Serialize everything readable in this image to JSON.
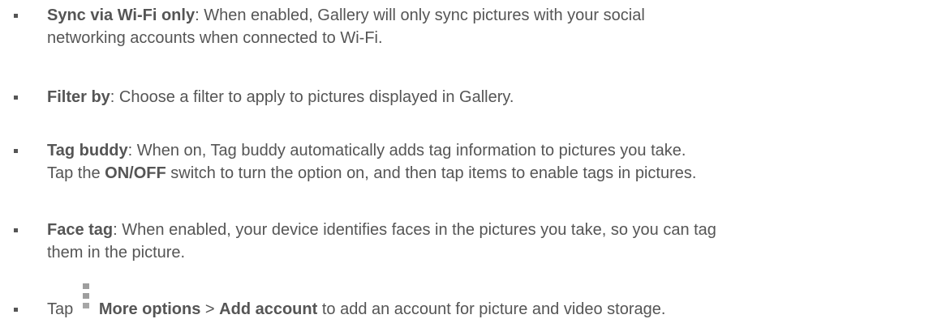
{
  "items": [
    {
      "term": "Sync via Wi-Fi only",
      "line1": ": When enabled, Gallery will only sync pictures with your social",
      "line2": "networking accounts when connected to Wi-Fi."
    },
    {
      "term": "Filter by",
      "line1": ": Choose a filter to apply to pictures displayed in Gallery."
    },
    {
      "term": "Tag buddy",
      "line1": ": When on, Tag buddy automatically adds tag information to pictures you take.",
      "line2_pre": "Tap the ",
      "line2_bold": "ON/OFF",
      "line2_post": " switch to turn the option on, and then tap items to enable tags in pictures."
    },
    {
      "term": "Face tag",
      "line1": ": When enabled, your device identifies faces in the pictures you take, so you can tag",
      "line2": "them in the picture."
    },
    {
      "pre": "Tap ",
      "icon": "more-options-icon",
      "more_options": "More options",
      "sep": " > ",
      "add_account": "Add account",
      "post": " to add an account for picture and video storage."
    }
  ]
}
